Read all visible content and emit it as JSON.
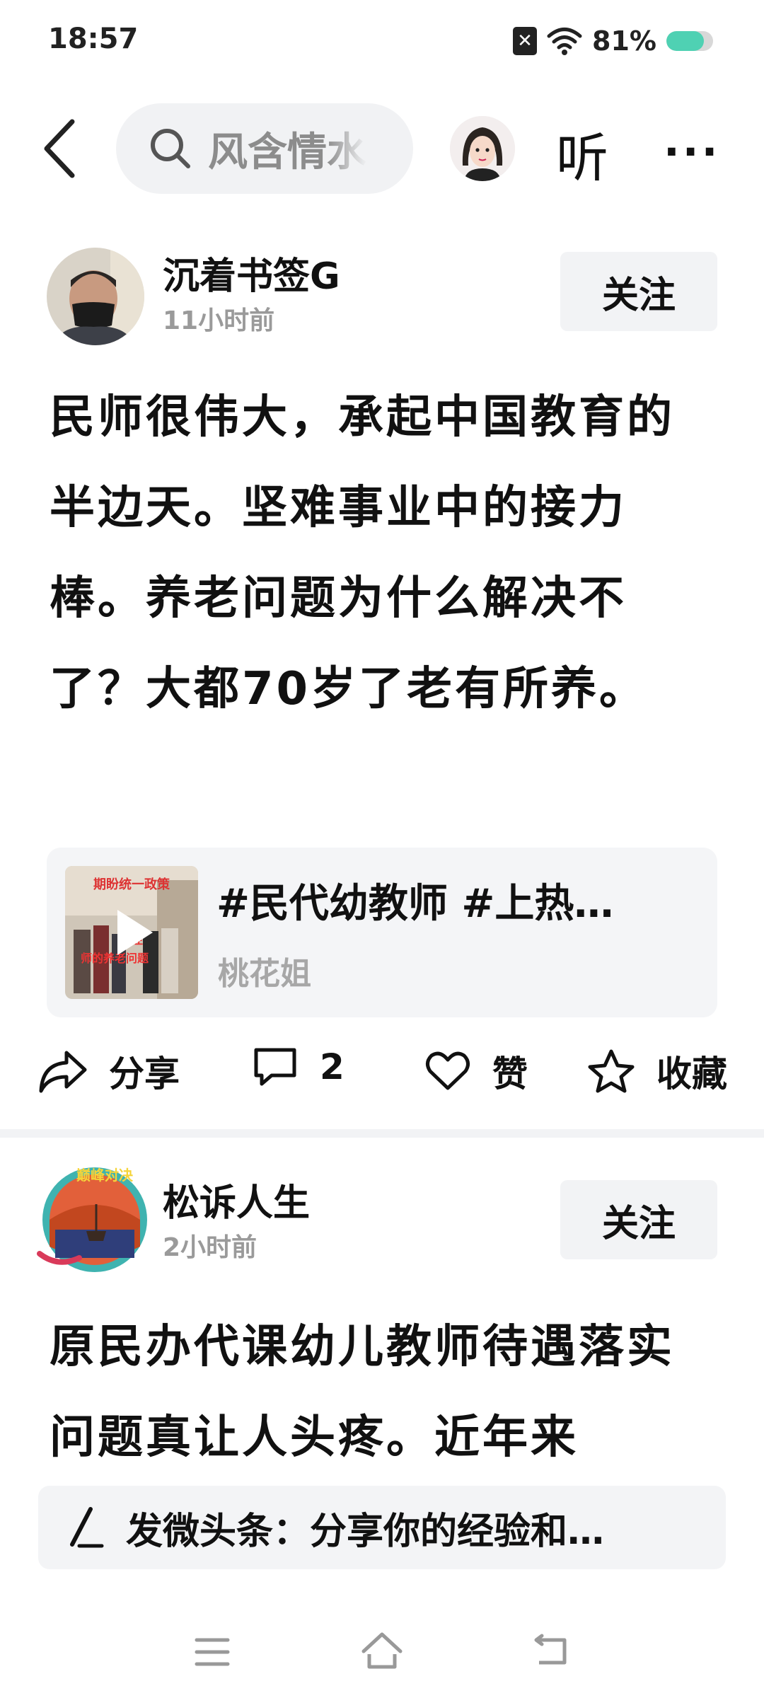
{
  "status_bar": {
    "time": "18:57",
    "battery_percent_label": "81%",
    "battery_level": 0.81,
    "sim_icon": "no-sim-icon",
    "wifi_icon": "wifi-icon"
  },
  "top_nav": {
    "search_text": "风含情水",
    "listen_label": "听",
    "more_label": "···"
  },
  "posts": [
    {
      "author": "沉着书签G",
      "time": "11小时前",
      "follow_label": "关注",
      "body": "民师很伟大，承起中国教育的半边天。坚难事业中的接力棒。养老问题为什么解决不了？大都70岁了老有所养。",
      "card": {
        "title": "#民代幼教师 #上热…",
        "source": "桃花姐",
        "thumb_caption_1": "期盼统一政策",
        "thumb_caption_2": "关注",
        "thumb_caption_3": "师的养老问题"
      },
      "actions": {
        "share": "分享",
        "comments": "2",
        "like": "赞",
        "favorite": "收藏"
      }
    },
    {
      "author": "松诉人生",
      "time": "2小时前",
      "follow_label": "关注",
      "avatar_badge": "巅峰对决",
      "body": "原民办代课幼儿教师待遇落实问题真让人头疼。近年来"
    }
  ],
  "composer": {
    "prompt": "发微头条：分享你的经验和…"
  },
  "colors": {
    "accent_battery": "#4fd1b3",
    "muted_text": "#9a9a9a",
    "button_bg": "#f2f3f5"
  }
}
